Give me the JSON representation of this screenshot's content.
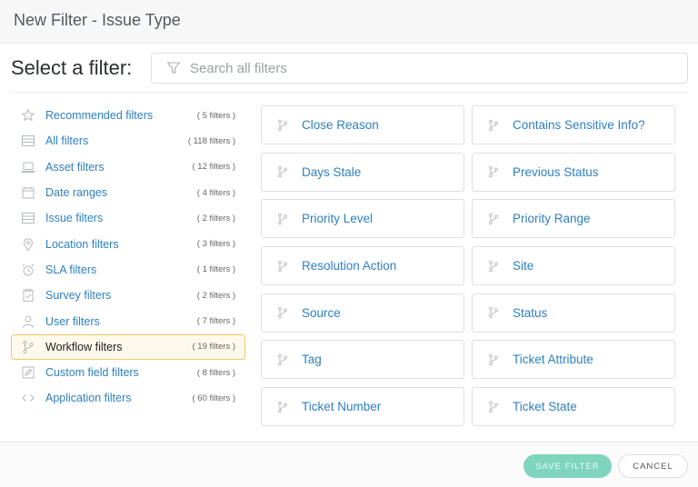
{
  "window": {
    "title": "New Filter - Issue Type"
  },
  "header": {
    "select_label": "Select a filter:"
  },
  "search": {
    "placeholder": "Search all filters",
    "value": "",
    "icon": "filter-funnel-icon"
  },
  "sidebar": {
    "items": [
      {
        "label": "Recommended filters",
        "count": "( 5 filters )",
        "icon": "star-icon"
      },
      {
        "label": "All filters",
        "count": "( 118 filters )",
        "icon": "list-icon"
      },
      {
        "label": "Asset filters",
        "count": "( 12 filters )",
        "icon": "laptop-icon"
      },
      {
        "label": "Date ranges",
        "count": "( 4 filters )",
        "icon": "calendar-icon"
      },
      {
        "label": "Issue filters",
        "count": "( 2 filters )",
        "icon": "list-icon"
      },
      {
        "label": "Location filters",
        "count": "( 3 filters )",
        "icon": "map-pin-icon"
      },
      {
        "label": "SLA filters",
        "count": "( 1 filters )",
        "icon": "alarm-clock-icon"
      },
      {
        "label": "Survey filters",
        "count": "( 2 filters )",
        "icon": "clipboard-check-icon"
      },
      {
        "label": "User filters",
        "count": "( 7 filters )",
        "icon": "user-icon"
      },
      {
        "label": "Workflow filters",
        "count": "( 19 filters )",
        "icon": "workflow-branch-icon",
        "active": true
      },
      {
        "label": "Custom field filters",
        "count": "( 8 filters )",
        "icon": "edit-field-icon"
      },
      {
        "label": "Application filters",
        "count": "( 60 filters )",
        "icon": "code-icon"
      }
    ]
  },
  "filters": [
    "Close Reason",
    "Contains Sensitive Info?",
    "Days Stale",
    "Previous Status",
    "Priority Level",
    "Priority Range",
    "Resolution Action",
    "Site",
    "Source",
    "Status",
    "Tag",
    "Ticket Attribute",
    "Ticket Number",
    "Ticket State"
  ],
  "footer": {
    "save_label": "SAVE FILTER",
    "cancel_label": "CANCEL"
  },
  "colors": {
    "link": "#2d7fc1",
    "active_bg": "#fef9ec",
    "active_border": "#f0c868",
    "save_button": "#7fd4bf"
  }
}
